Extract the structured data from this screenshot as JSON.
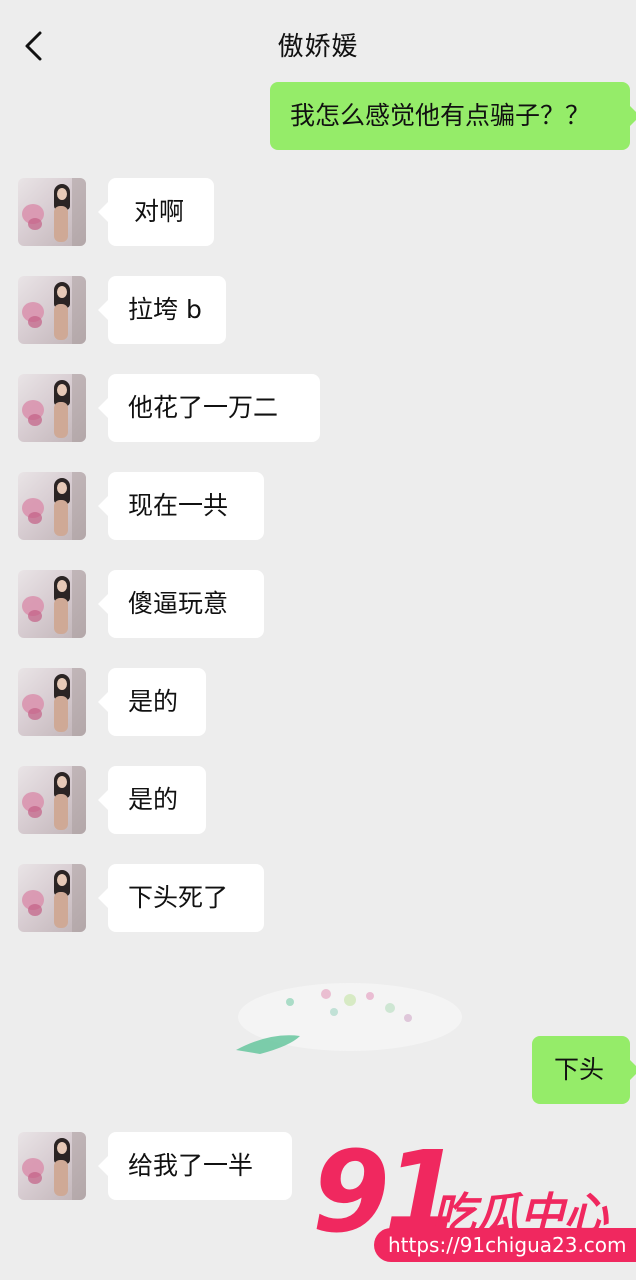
{
  "header": {
    "back_icon": "chevron-left-icon",
    "title": "傲娇媛"
  },
  "messages": [
    {
      "side": "right",
      "text": "我怎么感觉他有点骗子？？"
    },
    {
      "side": "left",
      "text": "对啊"
    },
    {
      "side": "left",
      "text": "拉垮 b"
    },
    {
      "side": "left",
      "text": "他花了一万二"
    },
    {
      "side": "left",
      "text": "现在一共"
    },
    {
      "side": "left",
      "text": "傻逼玩意"
    },
    {
      "side": "left",
      "text": "是的"
    },
    {
      "side": "left",
      "text": "是的"
    },
    {
      "side": "left",
      "text": "下头死了"
    },
    {
      "side": "right",
      "text": "下头"
    },
    {
      "side": "left",
      "text": "给我了一半"
    }
  ],
  "colors": {
    "background": "#ededed",
    "self_bubble": "#95ec69",
    "other_bubble": "#ffffff",
    "watermark": "#f0285f"
  },
  "watermark": {
    "number": "91",
    "name": "吃瓜中心",
    "url": "https://91chigua23.com"
  }
}
